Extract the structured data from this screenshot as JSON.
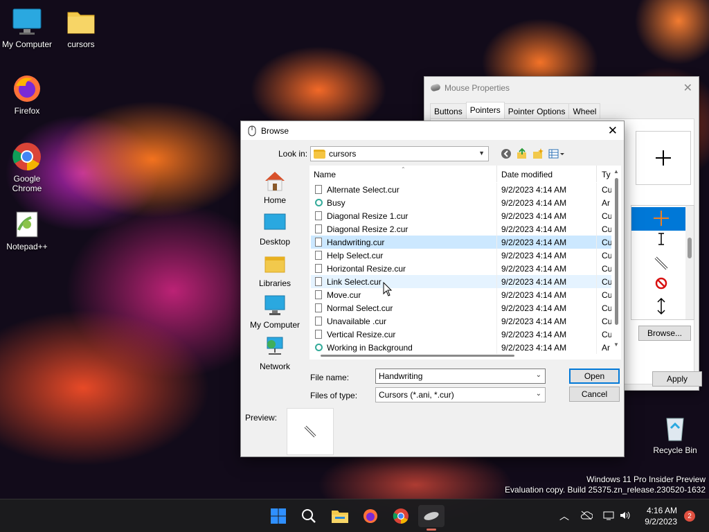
{
  "desktop": {
    "icons": [
      {
        "label": "My Computer"
      },
      {
        "label": "cursors"
      },
      {
        "label": "Firefox"
      },
      {
        "label": "Google Chrome"
      },
      {
        "label": "Notepad++"
      },
      {
        "label": "Recycle Bin"
      }
    ],
    "watermark": {
      "line1": "Windows 11 Pro Insider Preview",
      "line2": "Evaluation copy. Build 25375.zn_release.230520-1632"
    }
  },
  "mouse_properties": {
    "title": "Mouse Properties",
    "tabs": [
      "Buttons",
      "Pointers",
      "Pointer Options",
      "Wheel"
    ],
    "active_tab": "Pointers",
    "browse_label": "Browse...",
    "apply_label": "Apply"
  },
  "browse_dialog": {
    "title": "Browse",
    "look_in_label": "Look in:",
    "look_in_value": "cursors",
    "places": [
      {
        "label": "Home"
      },
      {
        "label": "Desktop"
      },
      {
        "label": "Libraries"
      },
      {
        "label": "My Computer"
      },
      {
        "label": "Network"
      }
    ],
    "columns": {
      "name": "Name",
      "date": "Date modified",
      "type": "Ty"
    },
    "files": [
      {
        "name": "Alternate Select.cur",
        "date": "9/2/2023 4:14 AM",
        "type": "Cu"
      },
      {
        "name": "Busy",
        "date": "9/2/2023 4:14 AM",
        "type": "Ar"
      },
      {
        "name": "Diagonal Resize 1.cur",
        "date": "9/2/2023 4:14 AM",
        "type": "Cu"
      },
      {
        "name": "Diagonal Resize 2.cur",
        "date": "9/2/2023 4:14 AM",
        "type": "Cu"
      },
      {
        "name": "Handwriting.cur",
        "date": "9/2/2023 4:14 AM",
        "type": "Cu"
      },
      {
        "name": "Help Select.cur",
        "date": "9/2/2023 4:14 AM",
        "type": "Cu"
      },
      {
        "name": "Horizontal Resize.cur",
        "date": "9/2/2023 4:14 AM",
        "type": "Cu"
      },
      {
        "name": "Link Select.cur",
        "date": "9/2/2023 4:14 AM",
        "type": "Cu"
      },
      {
        "name": "Move.cur",
        "date": "9/2/2023 4:14 AM",
        "type": "Cu"
      },
      {
        "name": "Normal Select.cur",
        "date": "9/2/2023 4:14 AM",
        "type": "Cu"
      },
      {
        "name": "Unavailable .cur",
        "date": "9/2/2023 4:14 AM",
        "type": "Cu"
      },
      {
        "name": "Vertical Resize.cur",
        "date": "9/2/2023 4:14 AM",
        "type": "Cu"
      },
      {
        "name": "Working in Background",
        "date": "9/2/2023 4:14 AM",
        "type": "Ar"
      }
    ],
    "selected_file": "Handwriting.cur",
    "hovered_file": "Link Select.cur",
    "file_name_label": "File name:",
    "file_name_value": "Handwriting",
    "files_of_type_label": "Files of type:",
    "files_of_type_value": "Cursors (*.ani, *.cur)",
    "open_label": "Open",
    "cancel_label": "Cancel",
    "preview_label": "Preview:"
  },
  "taskbar": {
    "time": "4:16 AM",
    "date": "9/2/2023",
    "notification_count": "2"
  },
  "colors": {
    "accent": "#0078d7",
    "selection": "#cce8ff",
    "hover": "#e5f3ff"
  }
}
